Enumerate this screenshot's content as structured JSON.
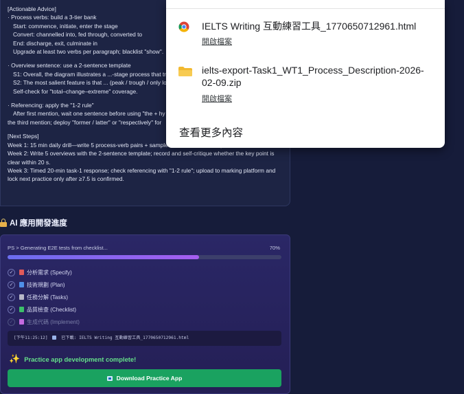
{
  "advice": {
    "lines": [
      "[Actionable Advice]",
      "· Process verbs: build a 3-tier bank",
      "Start: commence, initiate, enter the stage",
      "Convert: channelled into, fed through, converted to",
      "End: discharge, exit, culminate in",
      "Upgrade at least two verbs per paragraph; blacklist \"show\".",
      "· Overview sentence: use a 2-sentence template",
      "S1: Overall, the diagram illustrates a ...-stage process that tra",
      "S2: The most salient feature is that ... (peak / trough / only lo",
      "Self-check for \"total–change–extreme\" coverage.",
      "· Referencing: apply the \"1-2 rule\"",
      "After first mention, wait one sentence before using \"the + hy",
      "the third mention; deploy \"former / latter\" or \"respectively\" for",
      "[Next Steps]",
      "Week 1: 15 min daily drill—write 5 process-verb pairs + sample sentences; save as phone flash-cards.",
      "Week 2: Write 5 overviews with the 2-sentence template; record and self-critique whether the key point is",
      "clear within 20 s.",
      "Week 3: Timed 20-min task-1 response; check referencing with \"1-2 rule\"; upload to marking platform and",
      "lock next practice only after ≥7.5 is confirmed."
    ]
  },
  "progress_section": {
    "title": "AI 應用開發進度",
    "status_text": "PS > Generating E2E tests from checklist...",
    "percent_label": "70%",
    "percent": 70,
    "steps": [
      {
        "label": "分析需求 (Specify)",
        "state": "done",
        "color": "#e05a5a"
      },
      {
        "label": "技術規劃 (Plan)",
        "state": "done",
        "color": "#4f8fe8"
      },
      {
        "label": "任務分解 (Tasks)",
        "state": "done",
        "color": "#b7b7c8"
      },
      {
        "label": "品質檢查 (Checklist)",
        "state": "done",
        "color": "#3cbf6a"
      },
      {
        "label": "生成代碼 (Implement)",
        "state": "pending",
        "color": "#c46be0"
      }
    ],
    "log_time": "[下午11:25:12]",
    "log_text": "已下載: IELTS Writing 互動練習工具_1770650712961.html",
    "complete_text": "Practice app development complete!",
    "download_button": "Download Practice App"
  },
  "downloads_panel": {
    "items": [
      {
        "filename": "IELTS Writing 互動練習工具_1770650712961.html",
        "action": "開啟檔案",
        "icon": "chrome-icon"
      },
      {
        "filename_line1": "ielts-export-Task1_WT1_Process_Description-2026-",
        "filename_line2": "02-09.zip",
        "action": "開啟檔案",
        "icon": "folder-icon"
      }
    ],
    "show_more": "查看更多內容"
  }
}
